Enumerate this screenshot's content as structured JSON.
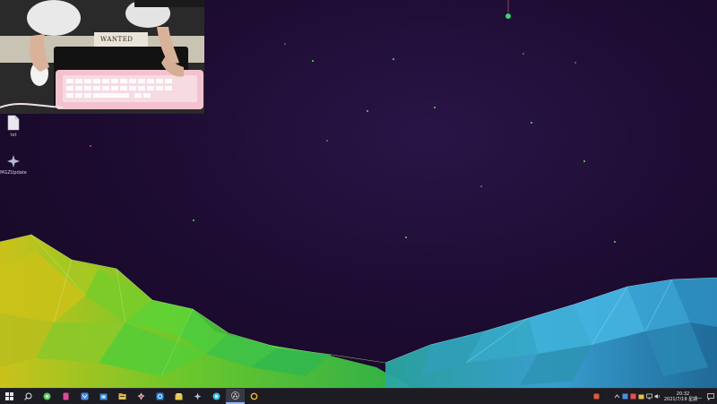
{
  "desktop": {
    "icons": [
      {
        "label": "txt",
        "icon": "file-icon"
      },
      {
        "label": "MGZUpdate",
        "icon": "app-icon"
      }
    ]
  },
  "webcam": {
    "banner_text": "WANTED"
  },
  "taskbar": {
    "buttons": [
      {
        "icon": "windows-start-icon"
      },
      {
        "icon": "search-icon"
      },
      {
        "icon": "browser-icon"
      },
      {
        "icon": "app-pink-icon"
      },
      {
        "icon": "app-blue-icon"
      },
      {
        "icon": "app-store-icon"
      },
      {
        "icon": "file-explorer-icon"
      },
      {
        "icon": "game-icon"
      },
      {
        "icon": "app-circle-icon"
      },
      {
        "icon": "folder-icon"
      },
      {
        "icon": "star-app-icon"
      },
      {
        "icon": "chat-icon"
      },
      {
        "icon": "obs-icon"
      },
      {
        "icon": "yellow-ring-icon"
      }
    ],
    "tray_icons": [
      "tray-red-icon",
      "chevron-up-icon",
      "tray-app-icon",
      "tray-app2-icon",
      "folder-tray-icon",
      "network-icon",
      "volume-icon"
    ],
    "clock": {
      "time": "20:32",
      "date": "2021/7/19 星期一"
    },
    "notification_icon": "notification-icon"
  },
  "colors": {
    "taskbar_bg": "#1c1c22",
    "desktop_bg": "#1e0c33",
    "accent_green": "#5ee04a",
    "accent_cyan": "#3fb8e8",
    "accent_yellow": "#d8d020"
  }
}
